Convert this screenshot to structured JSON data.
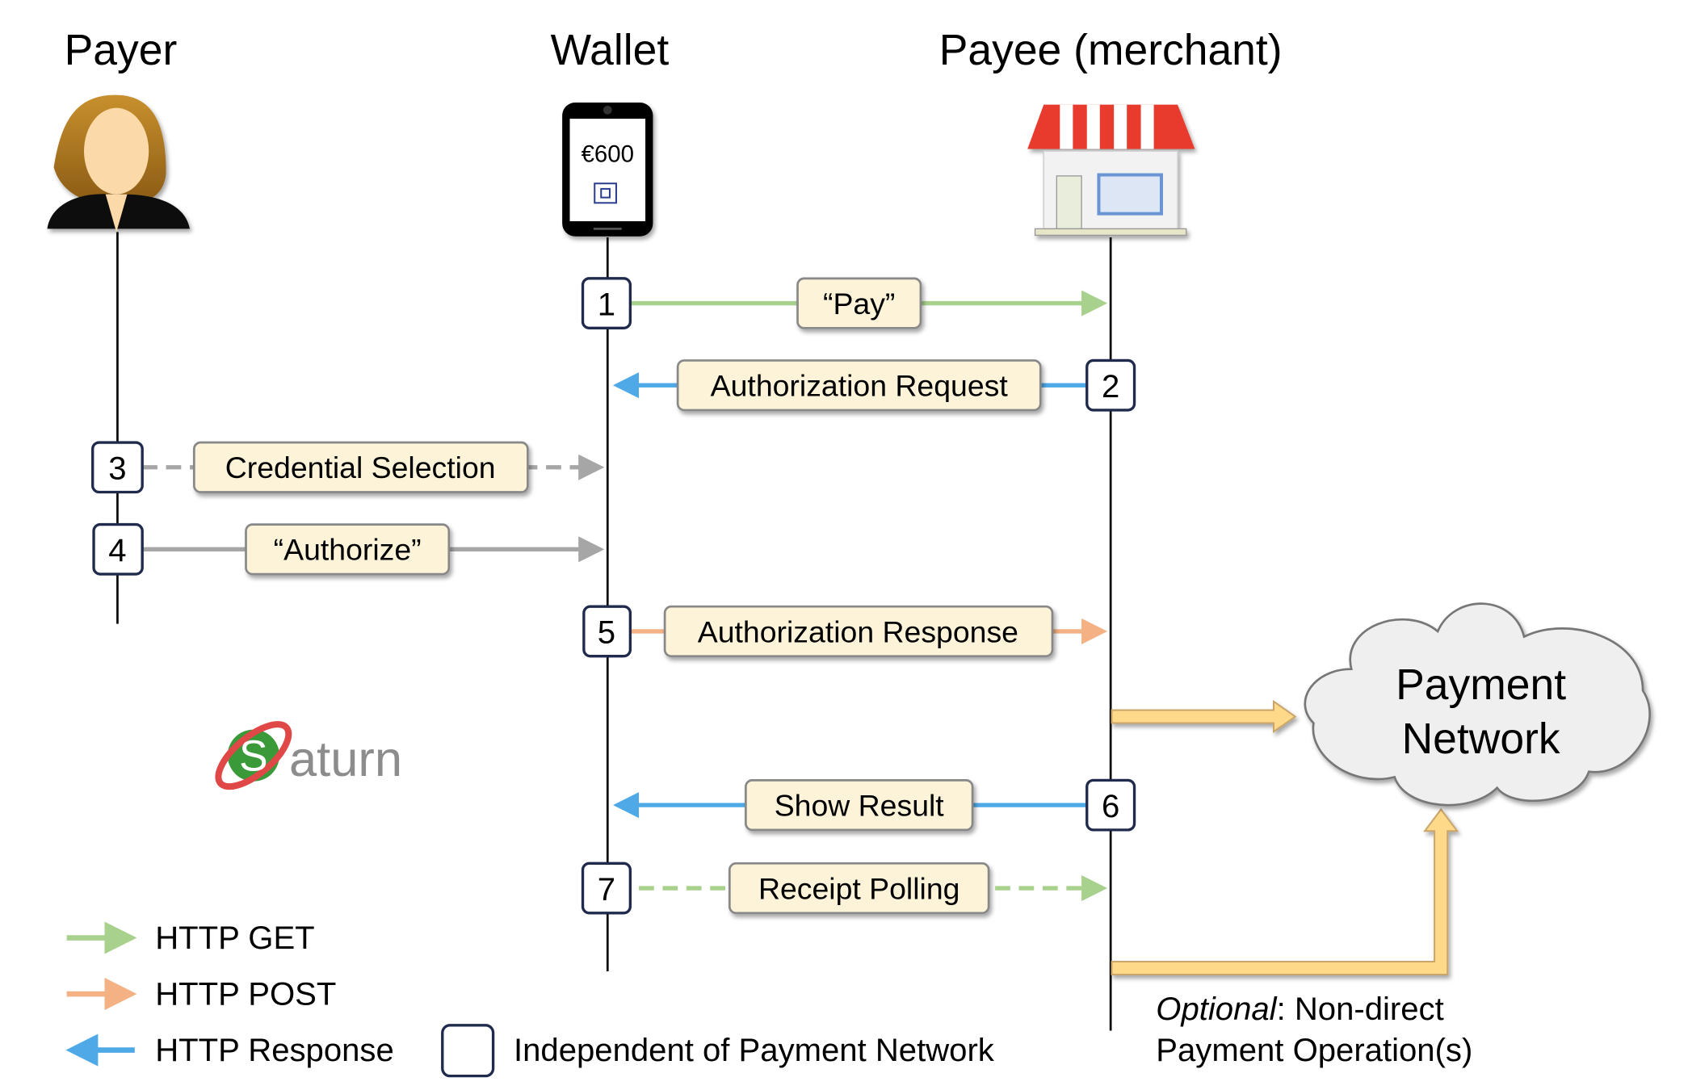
{
  "actors": {
    "payer": "Payer",
    "wallet": "Wallet",
    "payee": "Payee (merchant)"
  },
  "wallet_screen": {
    "amount": "€600"
  },
  "steps": [
    {
      "num": "1",
      "label": "“Pay”",
      "type": "HTTP GET"
    },
    {
      "num": "2",
      "label": "Authorization Request",
      "type": "HTTP Response"
    },
    {
      "num": "3",
      "label": "Credential Selection",
      "type": "local-dashed"
    },
    {
      "num": "4",
      "label": "“Authorize”",
      "type": "local"
    },
    {
      "num": "5",
      "label": "Authorization Response",
      "type": "HTTP POST"
    },
    {
      "num": "6",
      "label": "Show Result",
      "type": "HTTP Response"
    },
    {
      "num": "7",
      "label": "Receipt Polling",
      "type": "HTTP GET (dashed)"
    }
  ],
  "cloud": {
    "line1": "Payment",
    "line2": "Network"
  },
  "optional_note": {
    "italic": "Optional",
    "rest": ": Non-direct",
    "line2": "Payment Operation(s)"
  },
  "logo": {
    "text": "Saturn"
  },
  "legend": {
    "get": "HTTP GET",
    "post": "HTTP POST",
    "response": "HTTP Response",
    "independent": "Independent of Payment Network"
  },
  "colors": {
    "get": "#a9d18e",
    "post": "#f4b183",
    "response": "#4ea9e6",
    "local": "#a6a6a6",
    "label_fill": "#fdf3d8",
    "step_border": "#1f2a4d",
    "optional_arrow": "#ffd98a"
  }
}
